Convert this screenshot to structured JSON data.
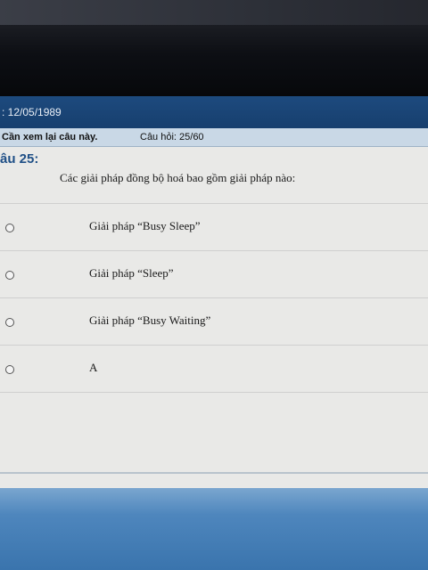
{
  "header": {
    "dob_text": ": 12/05/1989"
  },
  "info": {
    "review_label": "Cần xem lại câu này.",
    "question_counter": "Câu hỏi: 25/60"
  },
  "question": {
    "number_label": "âu 25:",
    "text": "Các giải pháp đồng bộ hoá bao gồm giải pháp nào:"
  },
  "options": [
    {
      "label": "Giải pháp “Busy Sleep”"
    },
    {
      "label": "Giải pháp “Sleep”"
    },
    {
      "label": "Giải pháp “Busy Waiting”"
    },
    {
      "label": "A"
    }
  ]
}
